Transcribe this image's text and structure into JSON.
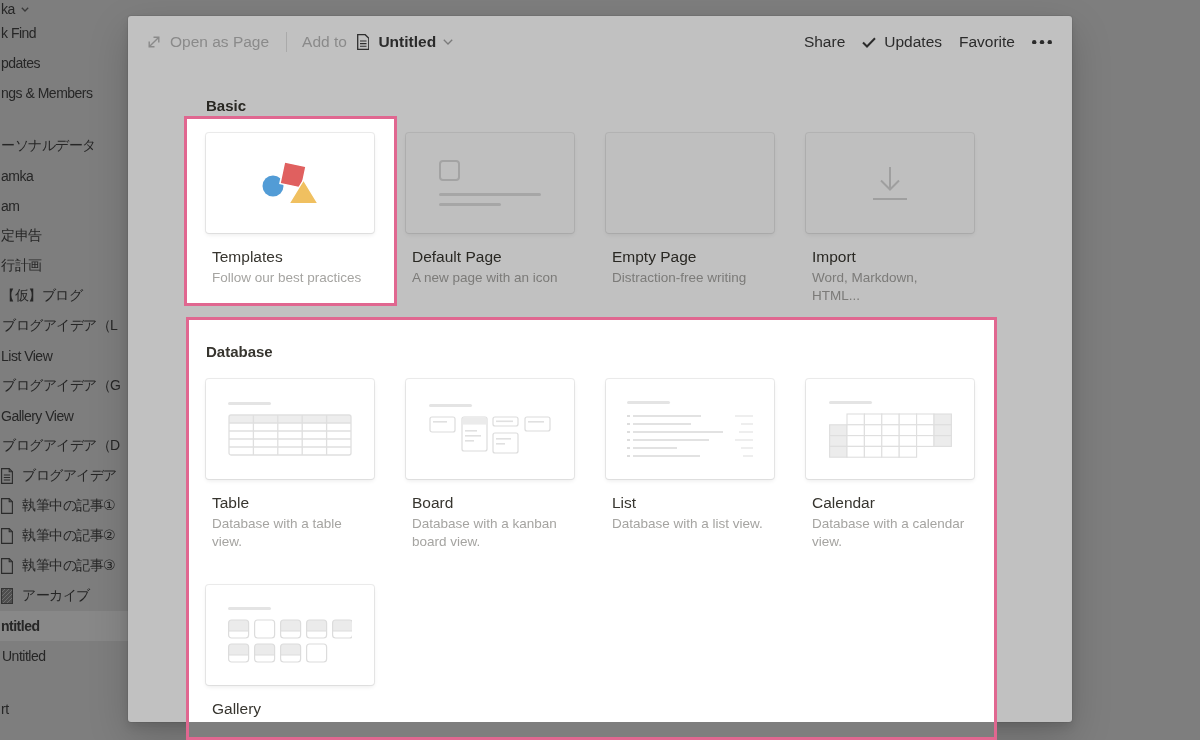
{
  "sidebar": {
    "workspace": {
      "label": "ka"
    },
    "sections": [
      {
        "items": [
          {
            "label": "k Find",
            "kind": "plain",
            "selected": false
          },
          {
            "label": "pdates",
            "kind": "plain",
            "selected": false
          },
          {
            "label": "ngs & Members",
            "kind": "plain",
            "selected": false
          }
        ]
      },
      {
        "items": [
          {
            "label": "ーソナルデータ",
            "kind": "plain",
            "selected": false
          },
          {
            "label": "amka",
            "kind": "plain",
            "selected": false
          },
          {
            "label": "am",
            "kind": "plain",
            "selected": false
          },
          {
            "label": "定申告",
            "kind": "plain",
            "selected": false
          },
          {
            "label": "行計画",
            "kind": "plain",
            "selected": false
          },
          {
            "label": "【仮】ブログ",
            "kind": "plain",
            "selected": false
          },
          {
            "label": "ブログアイデア（L",
            "kind": "indented",
            "selected": false
          },
          {
            "label": "List View",
            "kind": "plain",
            "selected": false
          },
          {
            "label": "ブログアイデア（G",
            "kind": "indented",
            "selected": false
          },
          {
            "label": "Gallery View",
            "kind": "plain",
            "selected": false
          },
          {
            "label": "ブログアイデア（D",
            "kind": "indented",
            "selected": false
          },
          {
            "label": "ブログアイデア",
            "kind": "page-text",
            "selected": false
          },
          {
            "label": "執筆中の記事①",
            "kind": "page",
            "selected": false
          },
          {
            "label": "執筆中の記事②",
            "kind": "page",
            "selected": false
          },
          {
            "label": "執筆中の記事③",
            "kind": "page",
            "selected": false
          },
          {
            "label": "アーカイブ",
            "kind": "image",
            "selected": false
          },
          {
            "label": "ntitled",
            "kind": "plain",
            "selected": true
          },
          {
            "label": "Untitled",
            "kind": "indented",
            "selected": false
          }
        ]
      },
      {
        "items": [
          {
            "label": "rt",
            "kind": "plain",
            "selected": false
          }
        ]
      }
    ]
  },
  "modal": {
    "toolbar": {
      "open_button": {
        "label": "Open as Page"
      },
      "add_to_label": "Add to",
      "page_selector": {
        "label": "Untitled"
      },
      "actions": [
        {
          "label": "Share",
          "kind": "plain"
        },
        {
          "label": "Updates",
          "kind": "check"
        },
        {
          "label": "Favorite",
          "kind": "plain"
        }
      ]
    },
    "sections": [
      {
        "heading": "Basic",
        "highlighted": false,
        "options": [
          {
            "kind": "templates",
            "title": "Templates",
            "description": "Follow our best practices",
            "highlighted": true
          },
          {
            "kind": "page",
            "title": "Default Page",
            "description": "A new page with an icon",
            "highlighted": false
          },
          {
            "kind": "empty",
            "title": "Empty Page",
            "description": "Distraction-free writing",
            "highlighted": false
          },
          {
            "kind": "import",
            "title": "Import",
            "description": "Word, Markdown, HTML...",
            "highlighted": false
          }
        ]
      },
      {
        "heading": "Database",
        "highlighted": true,
        "options": [
          {
            "kind": "table",
            "title": "Table",
            "description": "Database with a table view.",
            "highlighted": false
          },
          {
            "kind": "board",
            "title": "Board",
            "description": "Database with a kanban board view.",
            "highlighted": false
          },
          {
            "kind": "list",
            "title": "List",
            "description": "Database with a list view.",
            "highlighted": false
          },
          {
            "kind": "calendar",
            "title": "Calendar",
            "description": "Database with a calendar view.",
            "highlighted": false
          },
          {
            "kind": "gallery",
            "title": "Gallery",
            "highlighted": false
          }
        ]
      }
    ]
  }
}
